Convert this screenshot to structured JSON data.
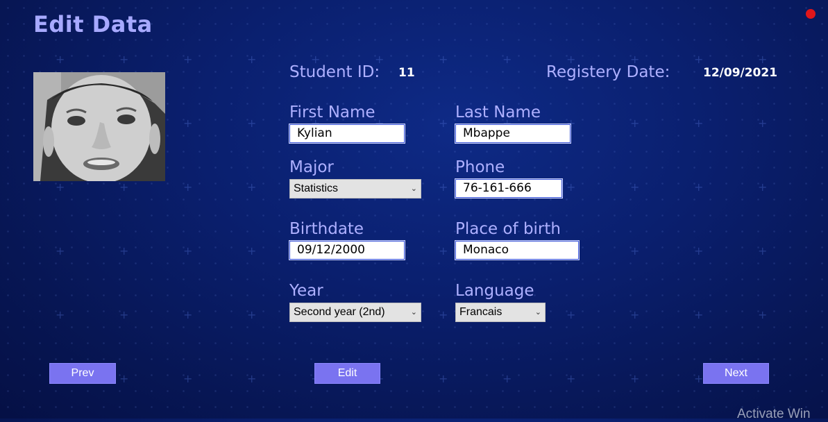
{
  "app": {
    "title": "Edit Data"
  },
  "colors": {
    "accent": "#7a73f0",
    "label": "#aeb0ff",
    "record_dot": "#e0161a",
    "bg": "#0a1f6e"
  },
  "record": {
    "student_id_label": "Student ID:",
    "student_id": "11",
    "registry_date_label": "Registery Date:",
    "registry_date": "12/09/2021"
  },
  "form": {
    "first_name_label": "First Name",
    "first_name": "Kylian",
    "last_name_label": "Last Name",
    "last_name": "Mbappe",
    "major_label": "Major",
    "major": "Statistics",
    "phone_label": "Phone",
    "phone": "76-161-666",
    "birthdate_label": "Birthdate",
    "birthdate": "09/12/2000",
    "place_of_birth_label": "Place of birth",
    "place_of_birth": "Monaco",
    "year_label": "Year",
    "year": "Second year (2nd)",
    "language_label": "Language",
    "language": "Francais"
  },
  "buttons": {
    "prev": "Prev",
    "edit": "Edit",
    "next": "Next"
  },
  "watermark": "Activate Win",
  "icons": {
    "dropdown": "chevron-down-icon",
    "photo": "student-photo"
  }
}
